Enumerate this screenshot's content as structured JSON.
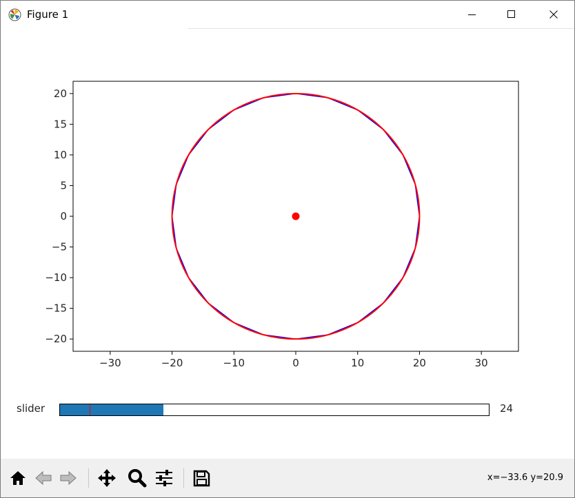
{
  "window": {
    "title": "Figure 1"
  },
  "chart_data": {
    "type": "line",
    "title": "",
    "xlabel": "",
    "ylabel": "",
    "xlim": [
      -36,
      36
    ],
    "ylim": [
      -22,
      22
    ],
    "xticks": [
      -30,
      -20,
      -10,
      0,
      10,
      20,
      30
    ],
    "yticks": [
      -20,
      -15,
      -10,
      -5,
      0,
      5,
      10,
      15,
      20
    ],
    "xtick_labels": [
      "−30",
      "−20",
      "−10",
      "0",
      "10",
      "20",
      "30"
    ],
    "ytick_labels": [
      "−20",
      "−15",
      "−10",
      "−5",
      "0",
      "5",
      "10",
      "15",
      "20"
    ],
    "grid": false,
    "series": [
      {
        "kind": "polygon",
        "color": "#0000ff",
        "radius": 20,
        "center": [
          0,
          0
        ],
        "vertices": 24
      },
      {
        "kind": "circle",
        "color": "#ff0000",
        "radius": 20,
        "center": [
          0,
          0
        ]
      },
      {
        "kind": "point",
        "color": "#ff0000",
        "x": 0,
        "y": 0
      }
    ]
  },
  "slider": {
    "label": "slider",
    "value": 24,
    "value_text": "24",
    "min": 3,
    "max": 90,
    "init": 9,
    "fill_color": "#1f77b4",
    "init_color": "#ff0000"
  },
  "toolbar": {
    "buttons": [
      "home-icon",
      "back-arrow-icon",
      "forward-arrow-icon",
      "pan-icon",
      "zoom-icon",
      "configure-subplots-icon",
      "save-icon"
    ],
    "coords": "x=−33.6 y=20.9"
  }
}
